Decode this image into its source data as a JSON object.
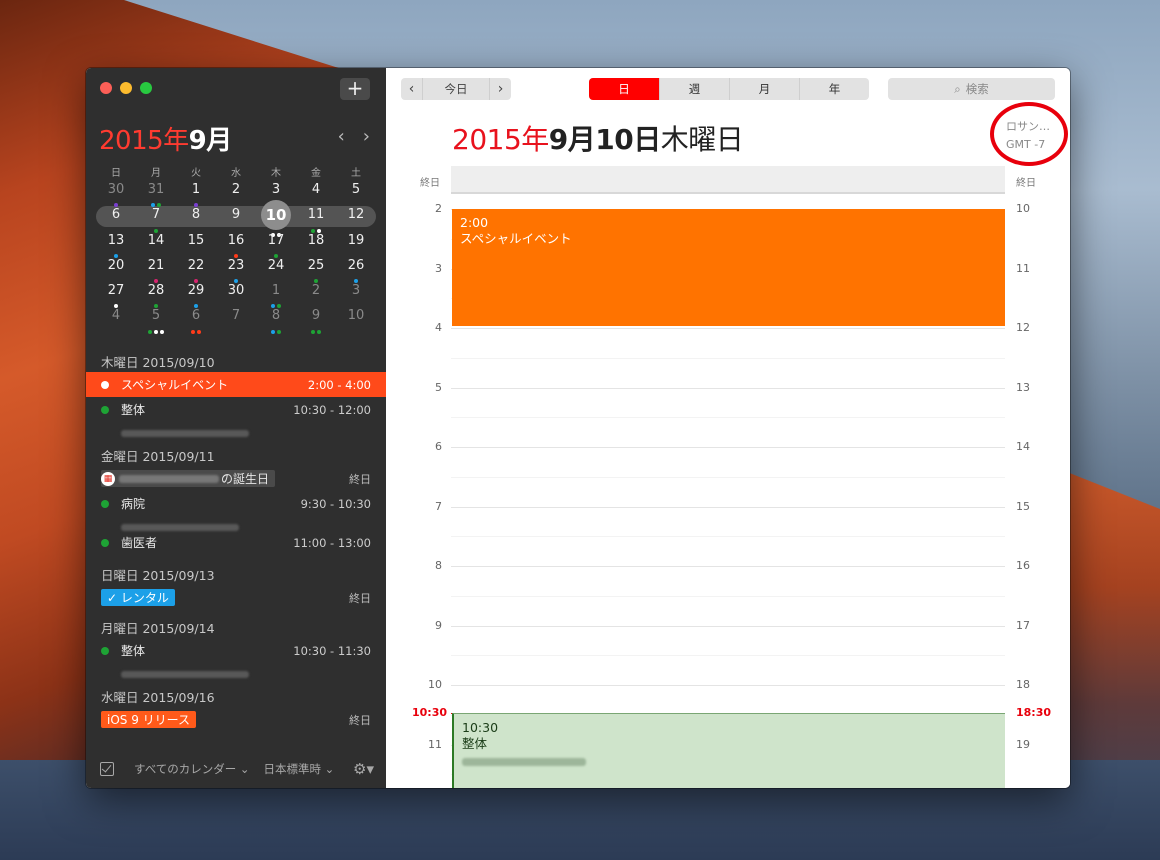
{
  "mini_calendar": {
    "year": "2015年",
    "month": "9月",
    "prev": "‹",
    "next": "›",
    "weekdays": [
      "日",
      "月",
      "火",
      "水",
      "木",
      "金",
      "土"
    ],
    "weeks": [
      [
        {
          "d": "30",
          "muted": true,
          "dots": [
            "#7a3fd1"
          ]
        },
        {
          "d": "31",
          "muted": true,
          "dots": [
            "#1ca0e8",
            "#1ea335"
          ]
        },
        {
          "d": "1",
          "dots": [
            "#7a3fd1"
          ]
        },
        {
          "d": "2"
        },
        {
          "d": "3",
          "dots": [
            "#1ea335"
          ]
        },
        {
          "d": "4"
        },
        {
          "d": "5"
        }
      ],
      [
        {
          "d": "6"
        },
        {
          "d": "7",
          "dots": [
            "#1ea335"
          ]
        },
        {
          "d": "8"
        },
        {
          "d": "9"
        },
        {
          "d": "10",
          "today": true,
          "dots": [
            "#ffffff",
            "#ffffff"
          ]
        },
        {
          "d": "11",
          "dots": [
            "#1ea335",
            "#ffffff"
          ]
        },
        {
          "d": "12"
        }
      ],
      [
        {
          "d": "13",
          "dots": [
            "#1ca0e8"
          ]
        },
        {
          "d": "14"
        },
        {
          "d": "15"
        },
        {
          "d": "16",
          "dots": [
            "#ff3b1a"
          ]
        },
        {
          "d": "17",
          "dots": [
            "#1ea335"
          ]
        },
        {
          "d": "18"
        },
        {
          "d": "19"
        }
      ],
      [
        {
          "d": "20"
        },
        {
          "d": "21",
          "dots": [
            "#d6246e"
          ]
        },
        {
          "d": "22",
          "dots": [
            "#d6246e"
          ]
        },
        {
          "d": "23",
          "dots": [
            "#1ca0e8"
          ]
        },
        {
          "d": "24"
        },
        {
          "d": "25",
          "dots": [
            "#1ea335"
          ]
        },
        {
          "d": "26",
          "dots": [
            "#1ca0e8"
          ]
        }
      ],
      [
        {
          "d": "27",
          "dots": [
            "#ffffff"
          ]
        },
        {
          "d": "28",
          "dots": [
            "#1ea335"
          ]
        },
        {
          "d": "29",
          "dots": [
            "#1ca0e8"
          ]
        },
        {
          "d": "30"
        },
        {
          "d": "1",
          "muted": true,
          "dots": [
            "#1ca0e8",
            "#1ea335"
          ]
        },
        {
          "d": "2",
          "muted": true
        },
        {
          "d": "3",
          "muted": true
        }
      ],
      [
        {
          "d": "4",
          "muted": true
        },
        {
          "d": "5",
          "muted": true,
          "dots": [
            "#1ea335",
            "#ffffff",
            "#ffffff"
          ]
        },
        {
          "d": "6",
          "muted": true,
          "dots": [
            "#ff3b1a",
            "#ff3b1a"
          ]
        },
        {
          "d": "7",
          "muted": true
        },
        {
          "d": "8",
          "muted": true,
          "dots": [
            "#1ca0e8",
            "#1ea335"
          ]
        },
        {
          "d": "9",
          "muted": true,
          "dots": [
            "#1ea335",
            "#1ea335"
          ]
        },
        {
          "d": "10",
          "muted": true
        }
      ]
    ]
  },
  "agenda": {
    "groups": [
      {
        "date": "木曜日 2015/09/10"
      },
      {
        "date": "金曜日 2015/09/11"
      },
      {
        "date": "日曜日 2015/09/13"
      },
      {
        "date": "月曜日 2015/09/14"
      },
      {
        "date": "水曜日 2015/09/16"
      }
    ],
    "events": {
      "special": {
        "title": "スペシャルイベント",
        "time": "2:00 - 4:00"
      },
      "seitai1": {
        "title": "整体",
        "time": "10:30 - 12:00"
      },
      "birthday": {
        "suffix": "の誕生日",
        "time": "終日",
        "icon": "birthday-icon"
      },
      "byouin": {
        "title": "病院",
        "time": "9:30 - 10:30"
      },
      "shikai": {
        "title": "歯医者",
        "time": "11:00 - 13:00"
      },
      "rental": {
        "title": "✓ レンタル",
        "time": "終日"
      },
      "seitai2": {
        "title": "整体",
        "time": "10:30 - 11:30"
      },
      "ios": {
        "title": "iOS 9 リリース",
        "time": "終日"
      }
    }
  },
  "footer": {
    "calendars": "すべてのカレンダー ⌄",
    "timezone": "日本標準時 ⌄",
    "gear": "⚙▾"
  },
  "toolbar": {
    "prev": "‹",
    "today": "今日",
    "next": "›",
    "views": [
      "日",
      "週",
      "月",
      "年"
    ],
    "active_view": "日",
    "search_icon": "⌕",
    "search_placeholder": "検索"
  },
  "day_view": {
    "title_year": "2015年",
    "title_date": "9月10日",
    "title_weekday": "木曜日",
    "timezone_name": "ロサン…",
    "timezone_offset": "GMT -7",
    "allday_left": "終日",
    "allday_right": "終日",
    "hours_left": [
      "2",
      "3",
      "4",
      "5",
      "6",
      "7",
      "8",
      "9",
      "10",
      "11"
    ],
    "hours_right": [
      "10",
      "11",
      "12",
      "13",
      "14",
      "15",
      "16",
      "17",
      "18",
      "19"
    ],
    "now_left": "10:30",
    "now_right": "18:30",
    "event_orange": {
      "time": "2:00",
      "title": "スペシャルイベント"
    },
    "event_green": {
      "time": "10:30",
      "title": "整体"
    }
  },
  "colors": {
    "accent_red": "#e8121d",
    "event_orange": "#ff7300",
    "event_green_bg": "#cfe4cb",
    "selection": "#ff4a1a"
  }
}
